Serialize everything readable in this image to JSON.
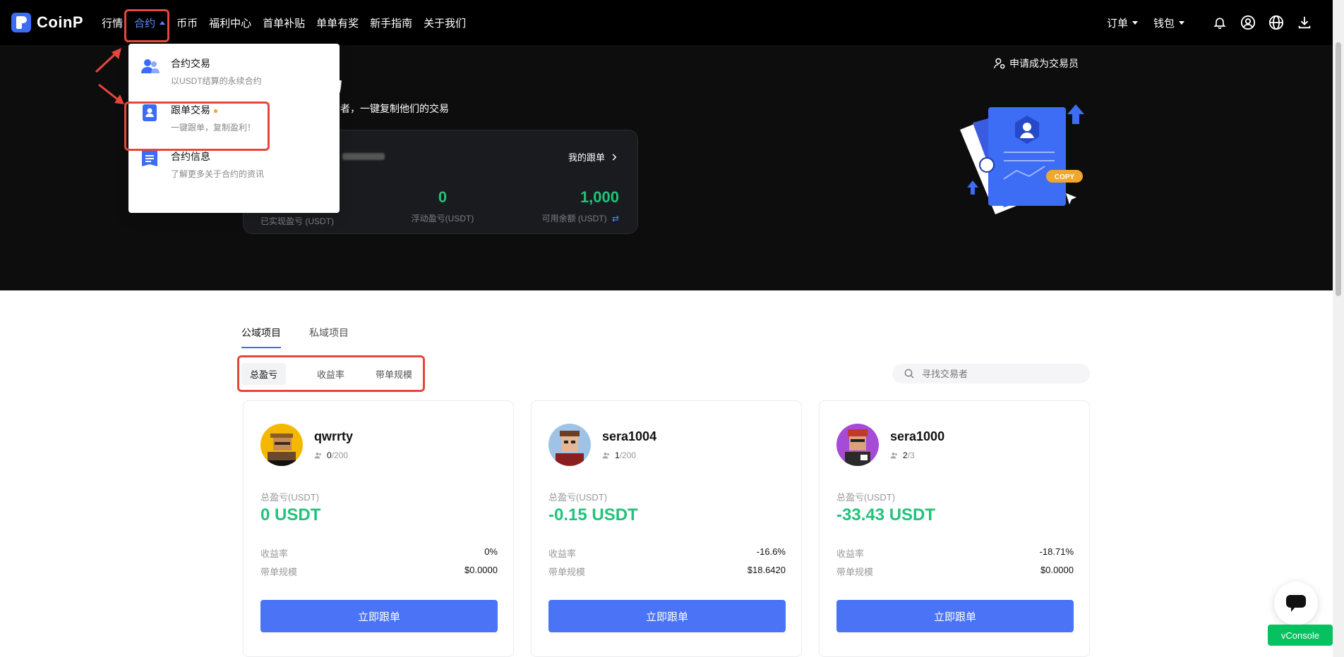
{
  "brand": {
    "name": "CoinP"
  },
  "nav": {
    "items": [
      "行情",
      "合约",
      "币币",
      "福利中心",
      "首单补贴",
      "单单有奖",
      "新手指南",
      "关于我们"
    ],
    "active_index": 1,
    "orders_label": "订单",
    "wallet_label": "钱包"
  },
  "dropdown": {
    "items": [
      {
        "title": "合约交易",
        "desc": "以USDT结算的永续合约",
        "icon": "users-icon"
      },
      {
        "title": "跟单交易",
        "desc": "一键跟单，复制盈利！",
        "icon": "copy-trade-icon"
      },
      {
        "title": "合约信息",
        "desc": "了解更多关于合约的资讯",
        "icon": "document-icon"
      }
    ]
  },
  "hero": {
    "title": "易",
    "subtitle": "币交易者，一键复制他们的交易",
    "apply_label": "申请成为交易员",
    "my_follow_label": "我的跟单",
    "stats": [
      {
        "value": "",
        "label": "已实现盈亏 (USDT)"
      },
      {
        "value": "0",
        "label": "浮动盈亏(USDT)"
      },
      {
        "value": "1,000",
        "label": "可用余额 (USDT)"
      }
    ],
    "copy_badge": "COPY"
  },
  "tabs": [
    "公域项目",
    "私域项目"
  ],
  "sort_options": [
    "总盈亏",
    "收益率",
    "带单规模"
  ],
  "search": {
    "placeholder": "寻找交易者"
  },
  "traders": [
    {
      "name": "qwrrty",
      "followers": "0",
      "capacity": "200",
      "pnl_label": "总盈亏(USDT)",
      "pnl": "0 USDT",
      "roi_label": "收益率",
      "roi": "0%",
      "aum_label": "带单规模",
      "aum": "$0.0000",
      "button": "立即跟单",
      "avatar_color": "#f5b800"
    },
    {
      "name": "sera1004",
      "followers": "1",
      "capacity": "200",
      "pnl_label": "总盈亏(USDT)",
      "pnl": "-0.15 USDT",
      "roi_label": "收益率",
      "roi": "-16.6%",
      "aum_label": "带单规模",
      "aum": "$18.6420",
      "button": "立即跟单",
      "avatar_color": "#9fc3e6"
    },
    {
      "name": "sera1000",
      "followers": "2",
      "capacity": "3",
      "pnl_label": "总盈亏(USDT)",
      "pnl": "-33.43 USDT",
      "roi_label": "收益率",
      "roi": "-18.71%",
      "aum_label": "带单规模",
      "aum": "$0.0000",
      "button": "立即跟单",
      "avatar_color": "#a64bd6"
    }
  ],
  "vconsole_label": "vConsole",
  "colors": {
    "accent": "#4a73f5",
    "positive": "#1fc37a",
    "annotation": "#e8453c",
    "vconsole": "#07c160"
  }
}
